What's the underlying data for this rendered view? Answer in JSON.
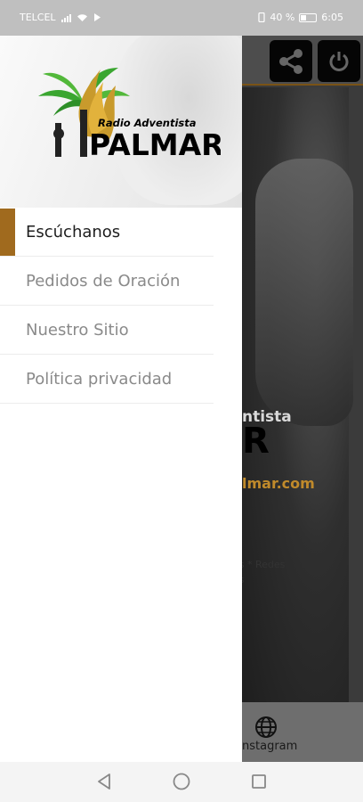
{
  "status_bar": {
    "carrier": "TELCEL",
    "battery": "40 %",
    "time": "6:05"
  },
  "drawer": {
    "logo": {
      "line1": "Radio Adventista",
      "line2": "PALMAR"
    },
    "menu": [
      {
        "label": "Escúchanos",
        "active": true
      },
      {
        "label": "Pedidos de Oración",
        "active": false
      },
      {
        "label": "Nuestro Sitio",
        "active": false
      },
      {
        "label": "Política privacidad",
        "active": false
      }
    ]
  },
  "background_app": {
    "title_partial_1": "ntista",
    "title_partial_2": "R",
    "url_partial": "lmar.com",
    "desc_partial": "es * Redes\nos",
    "bottom_nav_label": "nstagram",
    "icons": [
      "share-icon",
      "power-icon",
      "globe-icon"
    ]
  },
  "nav_bar": {
    "icons": [
      "back-icon",
      "home-icon",
      "recents-icon"
    ]
  },
  "colors": {
    "accent": "#a06a1e",
    "status_bar": "#bfbfbf"
  }
}
